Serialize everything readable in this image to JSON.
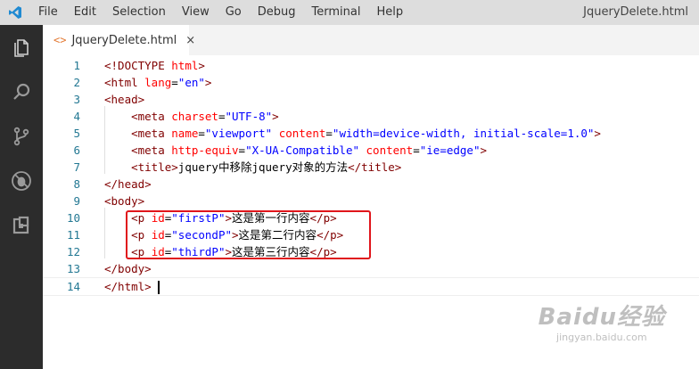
{
  "menubar": {
    "items": [
      "File",
      "Edit",
      "Selection",
      "View",
      "Go",
      "Debug",
      "Terminal",
      "Help"
    ],
    "window_title": "JqueryDelete.html"
  },
  "activitybar": {
    "icons": [
      "files-icon",
      "search-icon",
      "source-control-icon",
      "debug-icon",
      "extensions-icon"
    ]
  },
  "tab": {
    "icon": "<>",
    "label": "JqueryDelete.html",
    "close": "×"
  },
  "editor": {
    "lines": [
      {
        "n": "1",
        "indent": "",
        "parts": [
          [
            "t",
            "<!DOCTYPE "
          ],
          [
            "a",
            "html"
          ],
          [
            "t",
            ">"
          ]
        ]
      },
      {
        "n": "2",
        "indent": "",
        "parts": [
          [
            "t",
            "<html "
          ],
          [
            "a",
            "lang"
          ],
          [
            "tx",
            "="
          ],
          [
            "v",
            "\"en\""
          ],
          [
            "t",
            ">"
          ]
        ]
      },
      {
        "n": "3",
        "indent": "",
        "parts": [
          [
            "t",
            "<head>"
          ]
        ]
      },
      {
        "n": "4",
        "indent": "    ",
        "parts": [
          [
            "t",
            "<meta "
          ],
          [
            "a",
            "charset"
          ],
          [
            "tx",
            "="
          ],
          [
            "v",
            "\"UTF-8\""
          ],
          [
            "t",
            ">"
          ]
        ]
      },
      {
        "n": "5",
        "indent": "    ",
        "parts": [
          [
            "t",
            "<meta "
          ],
          [
            "a",
            "name"
          ],
          [
            "tx",
            "="
          ],
          [
            "v",
            "\"viewport\""
          ],
          [
            "tx",
            " "
          ],
          [
            "a",
            "content"
          ],
          [
            "tx",
            "="
          ],
          [
            "v",
            "\"width=device-width, initial-scale=1.0\""
          ],
          [
            "t",
            ">"
          ]
        ]
      },
      {
        "n": "6",
        "indent": "    ",
        "parts": [
          [
            "t",
            "<meta "
          ],
          [
            "a",
            "http-equiv"
          ],
          [
            "tx",
            "="
          ],
          [
            "v",
            "\"X-UA-Compatible\""
          ],
          [
            "tx",
            " "
          ],
          [
            "a",
            "content"
          ],
          [
            "tx",
            "="
          ],
          [
            "v",
            "\"ie=edge\""
          ],
          [
            "t",
            ">"
          ]
        ]
      },
      {
        "n": "7",
        "indent": "    ",
        "parts": [
          [
            "t",
            "<title>"
          ],
          [
            "tx",
            "jquery中移除jquery对象的方法"
          ],
          [
            "t",
            "</title>"
          ]
        ]
      },
      {
        "n": "8",
        "indent": "",
        "parts": [
          [
            "t",
            "</head>"
          ]
        ]
      },
      {
        "n": "9",
        "indent": "",
        "parts": [
          [
            "t",
            "<body>"
          ]
        ]
      },
      {
        "n": "10",
        "indent": "    ",
        "parts": [
          [
            "t",
            "<p "
          ],
          [
            "a",
            "id"
          ],
          [
            "tx",
            "="
          ],
          [
            "v",
            "\"firstP\""
          ],
          [
            "t",
            ">"
          ],
          [
            "tx",
            "这是第一行内容"
          ],
          [
            "t",
            "</p>"
          ]
        ]
      },
      {
        "n": "11",
        "indent": "    ",
        "parts": [
          [
            "t",
            "<p "
          ],
          [
            "a",
            "id"
          ],
          [
            "tx",
            "="
          ],
          [
            "v",
            "\"secondP\""
          ],
          [
            "t",
            ">"
          ],
          [
            "tx",
            "这是第二行内容"
          ],
          [
            "t",
            "</p>"
          ]
        ]
      },
      {
        "n": "12",
        "indent": "    ",
        "parts": [
          [
            "t",
            "<p "
          ],
          [
            "a",
            "id"
          ],
          [
            "tx",
            "="
          ],
          [
            "v",
            "\"thirdP\""
          ],
          [
            "t",
            ">"
          ],
          [
            "tx",
            "这是第三行内容"
          ],
          [
            "t",
            "</p>"
          ]
        ]
      },
      {
        "n": "13",
        "indent": "",
        "parts": [
          [
            "t",
            "</body>"
          ]
        ]
      },
      {
        "n": "14",
        "indent": "",
        "parts": [
          [
            "t",
            "</html>"
          ],
          [
            "tx",
            " "
          ]
        ]
      }
    ]
  },
  "watermark": {
    "main": "Baidu经验",
    "sub": "jingyan.baidu.com"
  },
  "colors": {
    "tag": "#800000",
    "attribute": "#ff0000",
    "value": "#0000ff",
    "highlight_box": "#e0151b",
    "line_numbers": "#237893"
  }
}
